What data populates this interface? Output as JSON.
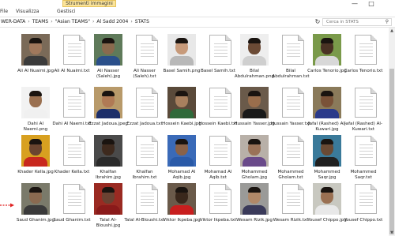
{
  "ribbon": {
    "context_group": "Strumenti immagini",
    "tabs": [
      "File",
      "Visualizza",
      "Gestisci"
    ],
    "window_controls": {
      "minimize": "—",
      "maximize": "□"
    }
  },
  "address_bar": {
    "breadcrumbs": [
      "WER-DATA",
      "TEAMS",
      "\"Asian TEAMS\"",
      "Al Sadd 2004",
      "STATS"
    ],
    "refresh_glyph": "↻",
    "search_placeholder": "Cerca in STATS",
    "search_glyph": "⚲"
  },
  "files": [
    {
      "name": "Ali Al Nuaimi.jpg",
      "kind": "photo",
      "skin": "#a0785c",
      "shirt": "#3b3b3b",
      "bg": "#7a6a58"
    },
    {
      "name": "Ali Al Nuaimi.txt",
      "kind": "text"
    },
    {
      "name": "Ali Nasser (Saleh).jpg",
      "kind": "photo",
      "skin": "#8a6a4e",
      "shirt": "#2a4f8a",
      "bg": "#5f7a5a"
    },
    {
      "name": "Ali Nasser (Saleh).txt",
      "kind": "text"
    },
    {
      "name": "Basel Samih.png",
      "kind": "photo",
      "skin": "#c79a7a",
      "shirt": "#b8b8b8",
      "bg": "#e8e8e8"
    },
    {
      "name": "Basel Samih.txt",
      "kind": "text"
    },
    {
      "name": "Bilal Abdulrahman.png",
      "kind": "photo",
      "skin": "#6b4a35",
      "shirt": "#cfcfcf",
      "bg": "#eeeeee"
    },
    {
      "name": "Bilal Abdulrahman.txt",
      "kind": "text"
    },
    {
      "name": "Carlos Tenorio.jpg",
      "kind": "photo",
      "skin": "#4a3224",
      "shirt": "#d8d8d8",
      "bg": "#7a9a4a"
    },
    {
      "name": "Carlos Tenorio.txt",
      "kind": "text"
    },
    {
      "name": "Dahi Al Naemi.png",
      "kind": "photo",
      "skin": "#9a7050",
      "shirt": "#f0f0f0",
      "bg": "#f2f2f2"
    },
    {
      "name": "Dahi Al Naemi.txt",
      "kind": "text"
    },
    {
      "name": "Ezzat Jadoua.jpeg",
      "kind": "photo",
      "skin": "#b07a55",
      "shirt": "#1d2f6a",
      "bg": "#b89a6a"
    },
    {
      "name": "Ezzat Jadoua.txt",
      "kind": "text"
    },
    {
      "name": "Hossein Kaebi.jpg",
      "kind": "photo",
      "skin": "#a8805e",
      "shirt": "#2f6a3a",
      "bg": "#5a4a3a"
    },
    {
      "name": "Hossein Kaebi.txt",
      "kind": "text"
    },
    {
      "name": "Hussain Yasser.jpg",
      "kind": "photo",
      "skin": "#9a6e4c",
      "shirt": "#1a1a1a",
      "bg": "#6a5a4a"
    },
    {
      "name": "Hussain Yasser.txt",
      "kind": "text"
    },
    {
      "name": "Jafal (Rashed) Al-Kuwari.jpg",
      "kind": "photo",
      "skin": "#7a5238",
      "shirt": "#2a3a8a",
      "bg": "#8a7a5a"
    },
    {
      "name": "Jafal (Rashed) Al-Kuwari.txt",
      "kind": "text"
    },
    {
      "name": "Khader Kella.jpg",
      "kind": "photo",
      "skin": "#6a4530",
      "shirt": "#c8281e",
      "bg": "#d8a020"
    },
    {
      "name": "Khader Kella.txt",
      "kind": "text"
    },
    {
      "name": "Khalfan Ibrahim.jpg",
      "kind": "photo",
      "skin": "#3e2a1e",
      "shirt": "#2a2a2a",
      "bg": "#4a4a4a"
    },
    {
      "name": "Khalfan Ibrahim.txt",
      "kind": "text"
    },
    {
      "name": "Mohamad Al Aqib.jpg",
      "kind": "photo",
      "skin": "#8a6248",
      "shirt": "#2a5aa8",
      "bg": "#3a6ab8"
    },
    {
      "name": "Mohamad Al Aqib.txt",
      "kind": "text"
    },
    {
      "name": "Mohammed Gholam.jpg",
      "kind": "photo",
      "skin": "#9a7258",
      "shirt": "#6a4a8a",
      "bg": "#b8b0a8"
    },
    {
      "name": "Mohammed Gholam.txt",
      "kind": "text"
    },
    {
      "name": "Mohammed Saqr.jpg",
      "kind": "photo",
      "skin": "#6a4a34",
      "shirt": "#202020",
      "bg": "#3a7a9a"
    },
    {
      "name": "Mohammed Saqr.txt",
      "kind": "text"
    },
    {
      "name": "Saud Ghanim.jpg",
      "kind": "photo",
      "skin": "#8a6a50",
      "shirt": "#3a3a3a",
      "bg": "#7a7a6a"
    },
    {
      "name": "Saud Ghanim.txt",
      "kind": "text"
    },
    {
      "name": "Talal Al-Bloushi.jpg",
      "kind": "photo",
      "skin": "#6a4232",
      "shirt": "#8a1a1a",
      "bg": "#9a2a22"
    },
    {
      "name": "Talal Al-Bloushi.txt",
      "kind": "text"
    },
    {
      "name": "Viktor Ikpeba.jpg",
      "kind": "photo",
      "skin": "#3a281c",
      "shirt": "#c81e1e",
      "bg": "#6a5a4a"
    },
    {
      "name": "Viktor Ikpeba.txt",
      "kind": "text"
    },
    {
      "name": "Wesam Rizik.jpg",
      "kind": "photo",
      "skin": "#b08868",
      "shirt": "#3a3a5a",
      "bg": "#9a9a98"
    },
    {
      "name": "Wesam Rizik.txt",
      "kind": "text"
    },
    {
      "name": "Yousef Chippo.jpg",
      "kind": "photo",
      "skin": "#9a7052",
      "shirt": "#e8e8e8",
      "bg": "#c8c8c0"
    },
    {
      "name": "Yousef Chippo.txt",
      "kind": "text"
    }
  ],
  "scrollbar": {
    "up": "▲",
    "down": "▼"
  }
}
